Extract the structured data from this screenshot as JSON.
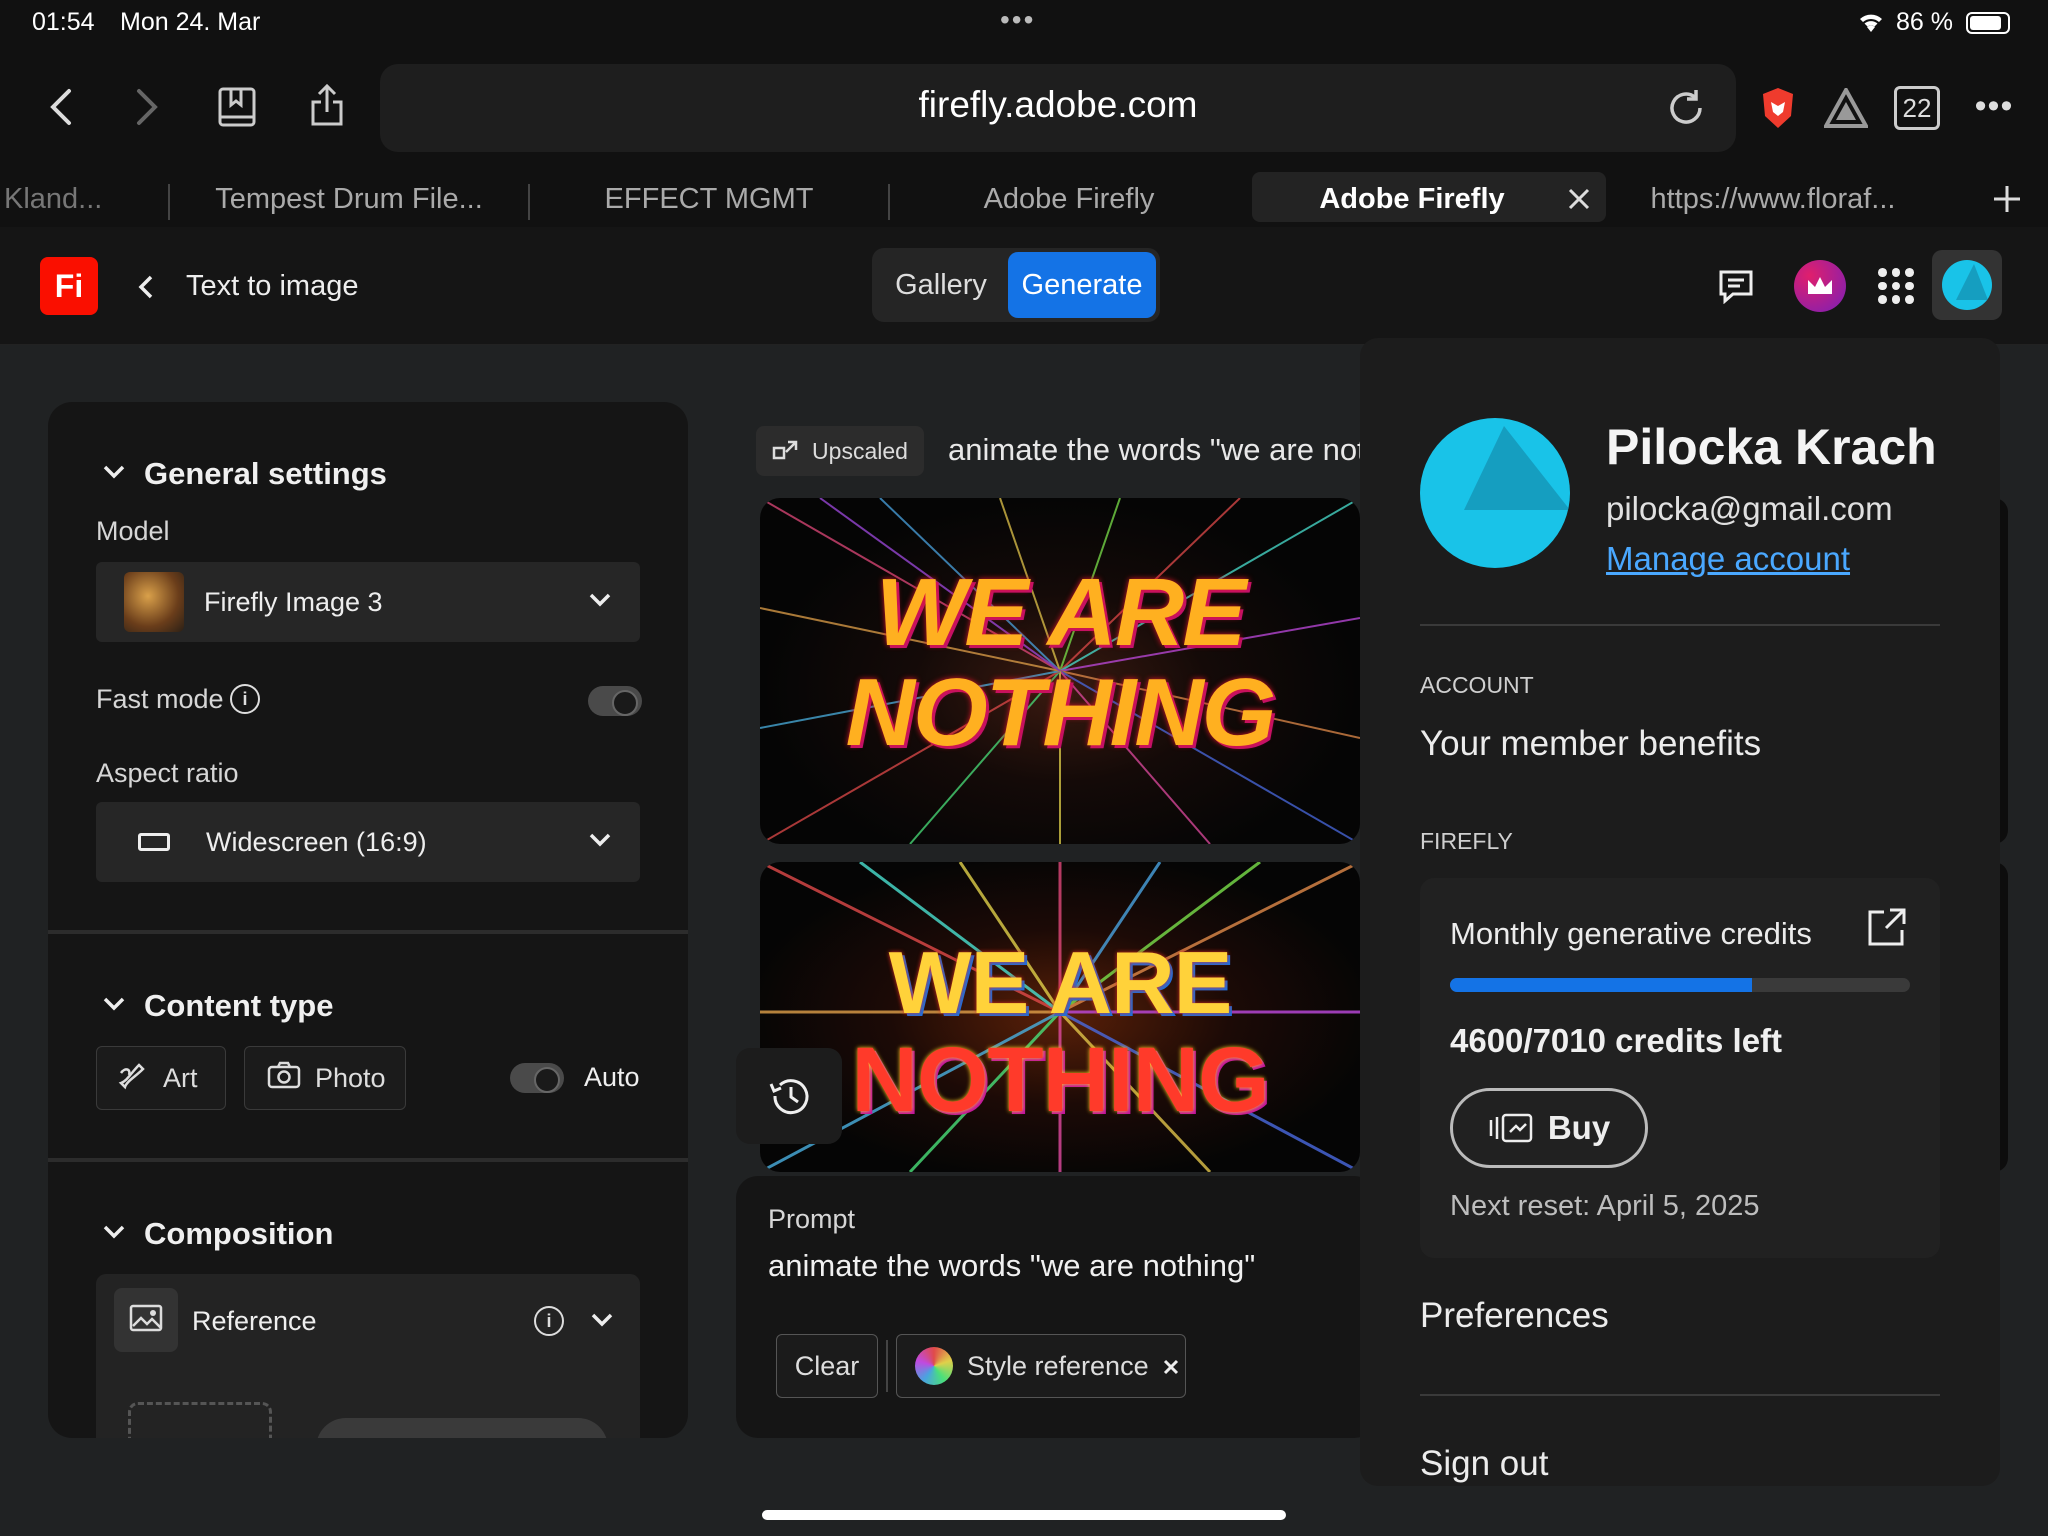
{
  "status": {
    "time": "01:54",
    "date": "Mon 24. Mar",
    "battery": "86 %",
    "dots": "•••"
  },
  "browser": {
    "url": "firefly.adobe.com",
    "tab_count": "22",
    "tabs": [
      {
        "label": "Kland..."
      },
      {
        "label": "Tempest Drum File..."
      },
      {
        "label": "EFFECT MGMT"
      },
      {
        "label": "Adobe Firefly"
      },
      {
        "label": "Adobe Firefly",
        "active": true
      },
      {
        "label": "https://www.floraf..."
      }
    ]
  },
  "app": {
    "logo": "Fi",
    "back_label": "Text to image",
    "view_toggle": {
      "gallery": "Gallery",
      "generate": "Generate"
    },
    "accent": "#1473e6"
  },
  "left_panel": {
    "general_settings": "General settings",
    "model_label": "Model",
    "model_value": "Firefly Image 3",
    "fast_mode_label": "Fast mode",
    "aspect_ratio_label": "Aspect ratio",
    "aspect_ratio_value": "Widescreen (16:9)",
    "content_type": "Content type",
    "art": "Art",
    "photo": "Photo",
    "auto": "Auto",
    "composition": "Composition",
    "reference": "Reference"
  },
  "results": {
    "badge": "Upscaled",
    "prompt_preview": "animate the words \"we are noth",
    "image_text_line1": "WE ARE",
    "image_text_line2": "NOTHING"
  },
  "prompt_box": {
    "label": "Prompt",
    "text": "animate the words \"we are nothing\"",
    "clear": "Clear",
    "style_reference": "Style reference"
  },
  "profile": {
    "name": "Pilocka Krach",
    "email": "pilocka@gmail.com",
    "manage": "Manage account",
    "account_heading": "ACCOUNT",
    "member_benefits": "Your member benefits",
    "firefly_heading": "FIREFLY",
    "credits_title": "Monthly generative credits",
    "credits_used": 4600,
    "credits_total": 7010,
    "credits_text": "4600/7010 credits left",
    "buy": "Buy",
    "next_reset": "Next reset: April 5, 2025",
    "preferences": "Preferences",
    "sign_out": "Sign out",
    "avatar_color": "#19c3e8"
  }
}
